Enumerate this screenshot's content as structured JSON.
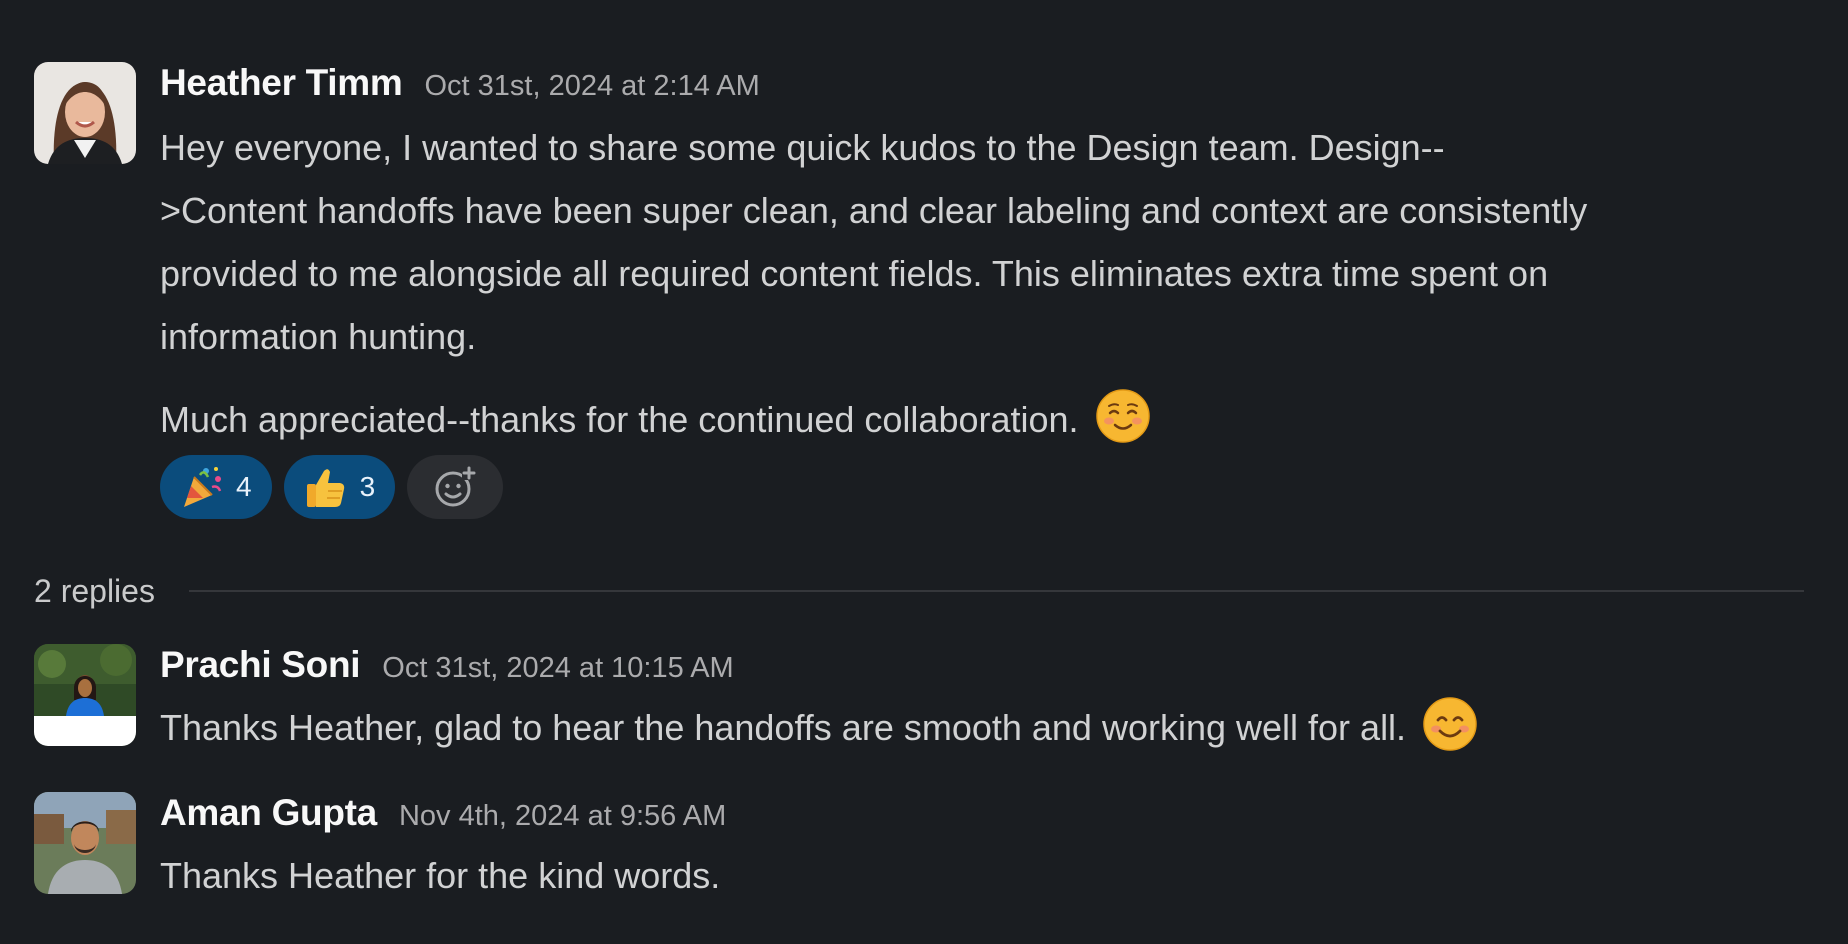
{
  "main_message": {
    "author": "Heather Timm",
    "timestamp": "Oct 31st, 2024 at 2:14 AM",
    "paragraph1_line1": "Hey everyone, I wanted to share some quick kudos to the Design team. Design--",
    "paragraph1_line2": ">Content handoffs have been super clean, and clear labeling and context are consistently",
    "paragraph1_line3": "provided to me alongside all required content fields. This eliminates extra time spent on",
    "paragraph1_line4": "information hunting.",
    "paragraph2": "Much appreciated--thanks for the continued collaboration.",
    "paragraph2_emoji": "relaxed-smiling-face",
    "reactions": [
      {
        "emoji": "party-popper-icon",
        "count": "4"
      },
      {
        "emoji": "thumbs-up-icon",
        "count": "3"
      }
    ],
    "add_reaction_icon": "add-reaction-icon"
  },
  "replies_label": "2 replies",
  "replies": [
    {
      "author": "Prachi Soni",
      "timestamp": "Oct 31st, 2024 at 10:15 AM",
      "text": "Thanks Heather, glad to hear the handoffs are smooth and working well for all.",
      "emoji": "smiling-face-icon"
    },
    {
      "author": "Aman Gupta",
      "timestamp": "Nov 4th, 2024 at 9:56 AM",
      "text": "Thanks Heather for the kind words."
    }
  ],
  "colors": {
    "background": "#1a1d21",
    "reaction_active": "#0b4c7c",
    "reaction_neutral": "#2b2d31",
    "author": "#f8f8f8",
    "timestamp": "#ababad",
    "text": "#d1d2d3"
  }
}
